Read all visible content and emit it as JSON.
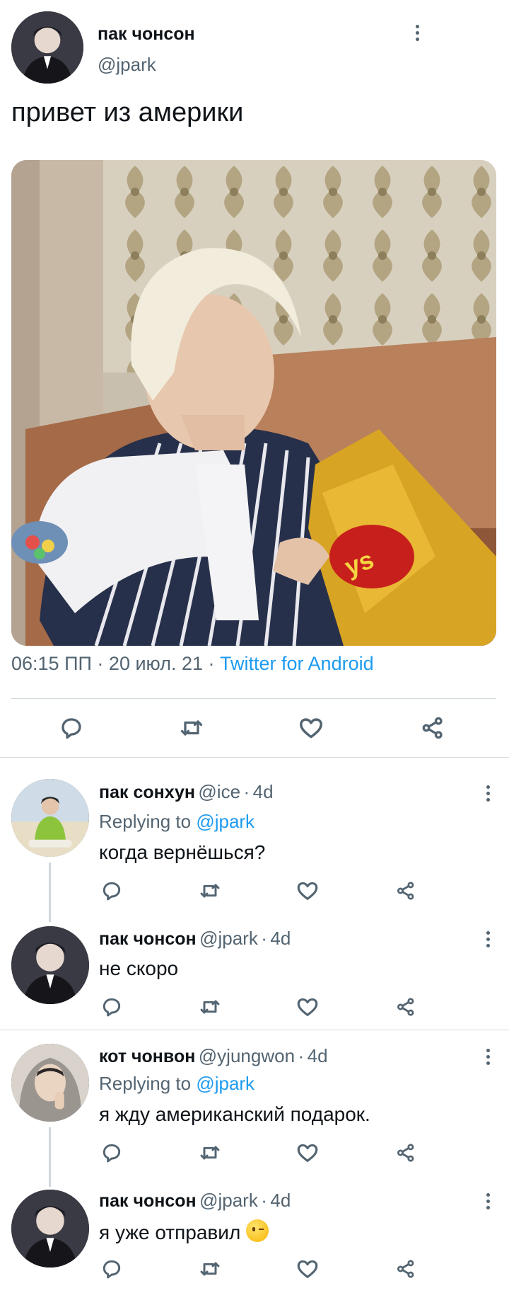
{
  "tweet": {
    "author_name": "пак чонсон",
    "author_handle": "@jpark",
    "text": "привет из америки",
    "photo_icon": "photo-of-person-with-chips",
    "time": "06:15 ПП",
    "date": "20 июл. 21",
    "source": "Twitter for Android",
    "sep": "·"
  },
  "actions": {
    "reply_icon": "reply-icon",
    "retweet_icon": "retweet-icon",
    "like_icon": "heart-icon",
    "share_icon": "share-icon"
  },
  "replies": [
    {
      "name": "пак сонхун",
      "handle": "@ice",
      "sep": "·",
      "age": "4d",
      "replying_prefix": "Replying to",
      "replying_to": "@jpark",
      "text": "когда вернёшься?"
    },
    {
      "name": "пак чонсон",
      "handle": "@jpark",
      "sep": "·",
      "age": "4d",
      "text": "не скоро"
    },
    {
      "name": "кот чонвон",
      "handle": "@yjungwon",
      "sep": "·",
      "age": "4d",
      "replying_prefix": "Replying to",
      "replying_to": "@jpark",
      "text": "я жду американский подарок."
    },
    {
      "name": "пак чонсон",
      "handle": "@jpark",
      "sep": "·",
      "age": "4d",
      "text": "я уже отправил",
      "emoji": "winking-face"
    }
  ],
  "colors": {
    "link": "#1d9bf0",
    "secondary": "#536471",
    "divider": "#cfd9de",
    "text": "#0f1419"
  }
}
